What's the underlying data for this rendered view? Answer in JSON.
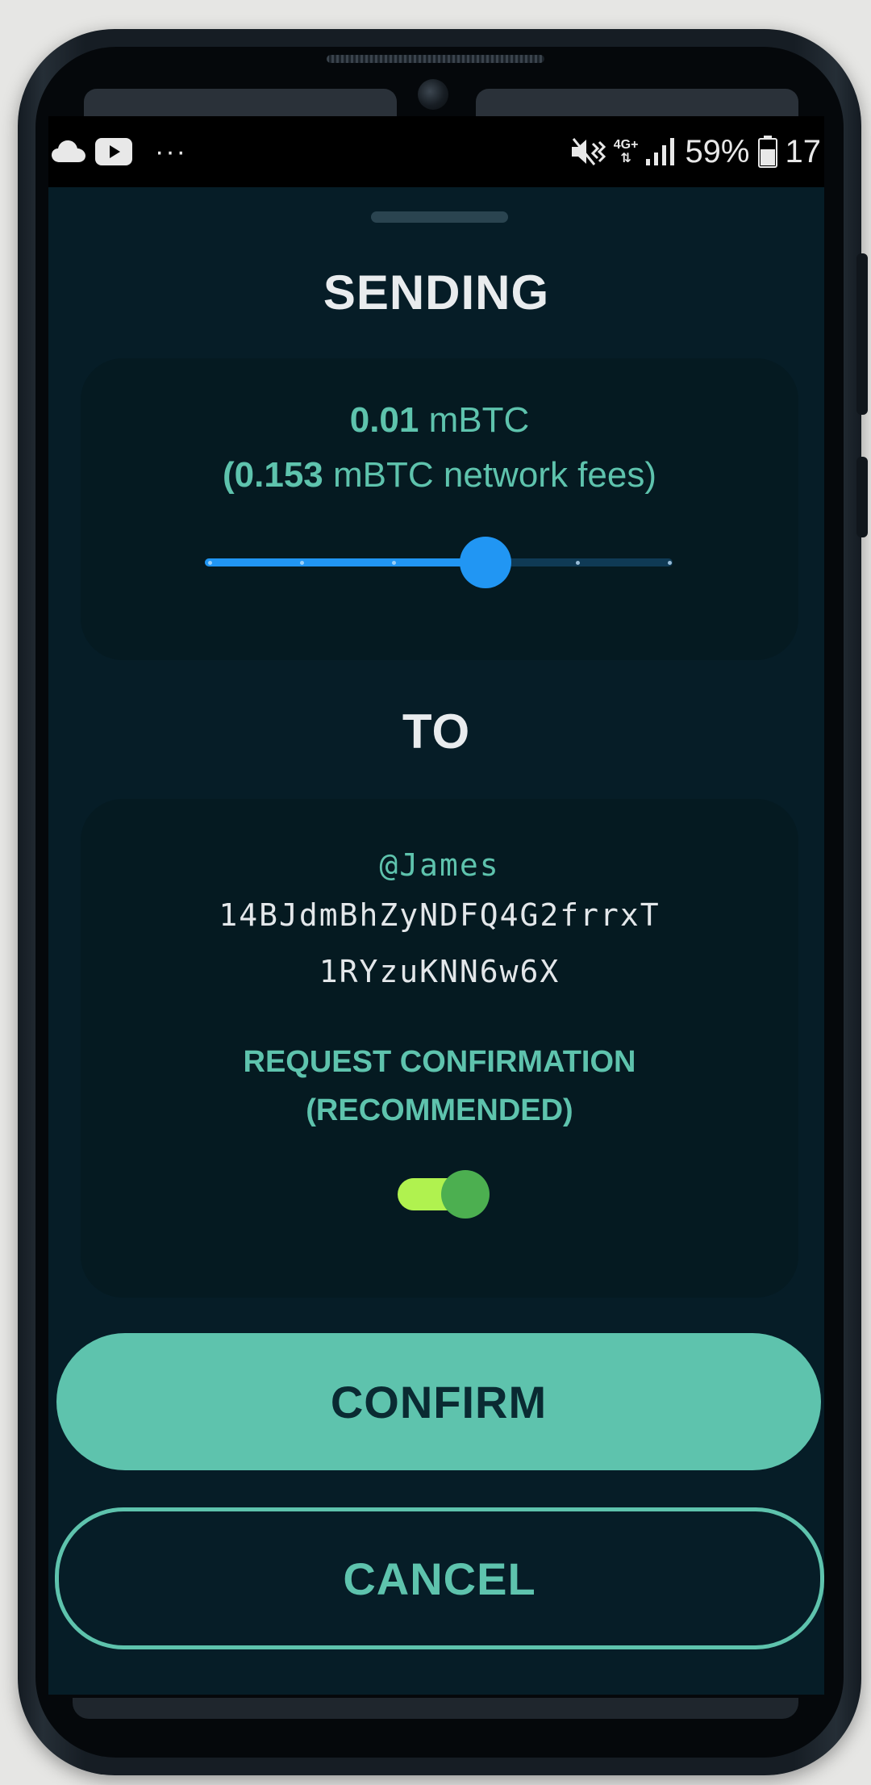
{
  "status_bar": {
    "left_icons": [
      "cloud-icon",
      "youtube-icon"
    ],
    "more": "···",
    "network_top": "4G+",
    "network_bottom": "⇅",
    "battery_percent": "59%",
    "time": "17"
  },
  "sending": {
    "title": "SENDING",
    "amount_value": "0.01",
    "amount_unit": "mBTC",
    "fee_open": "(",
    "fee_value": "0.153",
    "fee_text": "mBTC network fees)",
    "fee_level": 0.6,
    "slider_steps": 6
  },
  "recipient": {
    "title": "TO",
    "handle": "@James",
    "address_line1": "14BJdmBhZyNDFQ4G2frrxT",
    "address_line2": "1RYzuKNN6w6X",
    "confirmation_label_line1": "REQUEST CONFIRMATION",
    "confirmation_label_line2": "(RECOMMENDED)",
    "confirmation_enabled": true
  },
  "actions": {
    "confirm_label": "CONFIRM",
    "cancel_label": "CANCEL"
  },
  "colors": {
    "accent": "#5ec3ad",
    "slider": "#2196f3",
    "toggle_track": "#b0f24f",
    "toggle_thumb": "#4caf50",
    "background": "#061d27",
    "card": "#051a21"
  }
}
